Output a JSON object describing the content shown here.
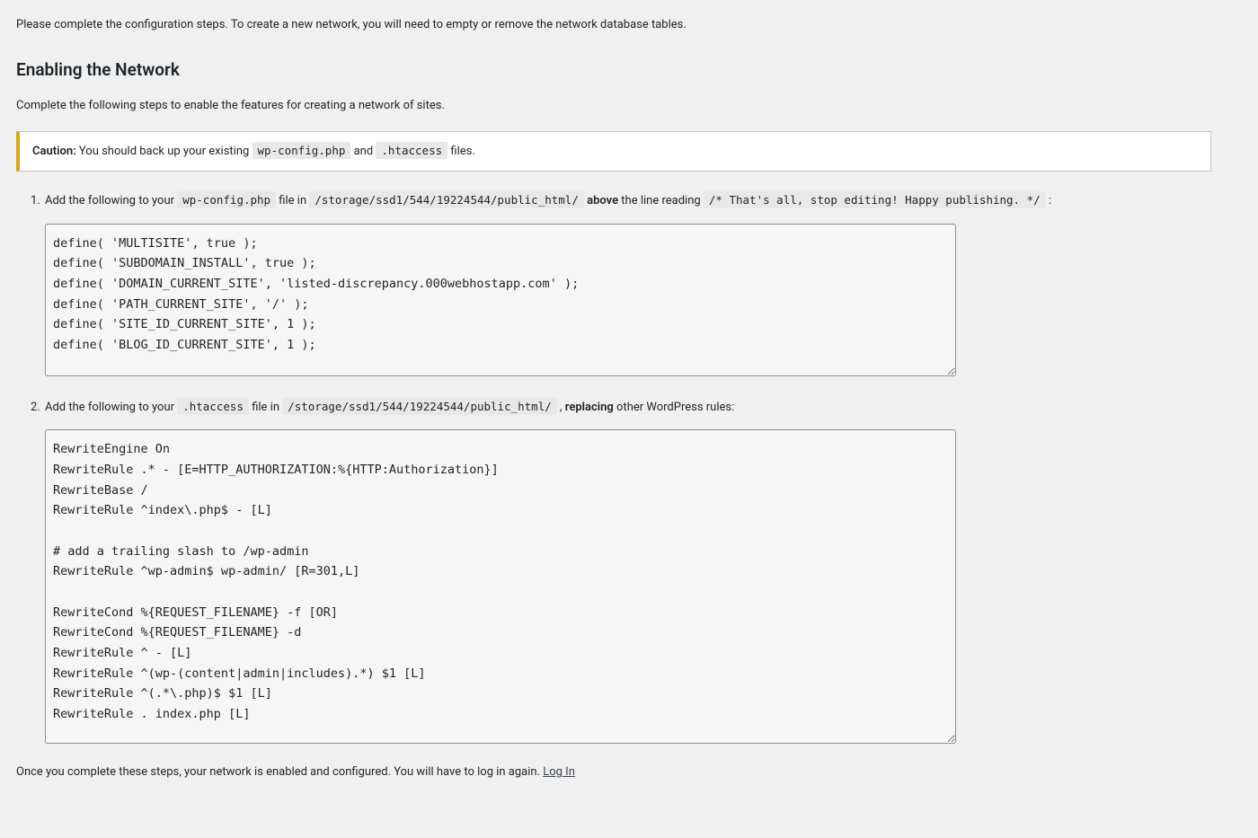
{
  "intro": "Please complete the configuration steps. To create a new network, you will need to empty or remove the network database tables.",
  "heading": "Enabling the Network",
  "subtitle": "Complete the following steps to enable the features for creating a network of sites.",
  "caution": {
    "label": "Caution:",
    "before_code1": " You should back up your existing ",
    "code1": "wp-config.php",
    "between": " and ",
    "code2": ".htaccess",
    "after": " files."
  },
  "step1": {
    "prefix": "Add the following to your ",
    "file": "wp-config.php",
    "middle1": " file in ",
    "path": "/storage/ssd1/544/19224544/public_html/",
    "middle2": " ",
    "bold": "above",
    "middle3": " the line reading ",
    "stopline": "/* That's all, stop editing! Happy publishing. */",
    "suffix": " :",
    "code": "define( 'MULTISITE', true );\ndefine( 'SUBDOMAIN_INSTALL', true );\ndefine( 'DOMAIN_CURRENT_SITE', 'listed-discrepancy.000webhostapp.com' );\ndefine( 'PATH_CURRENT_SITE', '/' );\ndefine( 'SITE_ID_CURRENT_SITE', 1 );\ndefine( 'BLOG_ID_CURRENT_SITE', 1 );"
  },
  "step2": {
    "prefix": "Add the following to your ",
    "file": ".htaccess",
    "middle1": " file in ",
    "path": "/storage/ssd1/544/19224544/public_html/",
    "middle2": " , ",
    "bold": "replacing",
    "suffix": " other WordPress rules:",
    "code": "RewriteEngine On\nRewriteRule .* - [E=HTTP_AUTHORIZATION:%{HTTP:Authorization}]\nRewriteBase /\nRewriteRule ^index\\.php$ - [L]\n\n# add a trailing slash to /wp-admin\nRewriteRule ^wp-admin$ wp-admin/ [R=301,L]\n\nRewriteCond %{REQUEST_FILENAME} -f [OR]\nRewriteCond %{REQUEST_FILENAME} -d\nRewriteRule ^ - [L]\nRewriteRule ^(wp-(content|admin|includes).*) $1 [L]\nRewriteRule ^(.*\\.php)$ $1 [L]\nRewriteRule . index.php [L]"
  },
  "closing": {
    "text": "Once you complete these steps, your network is enabled and configured. You will have to log in again. ",
    "link": "Log In"
  }
}
